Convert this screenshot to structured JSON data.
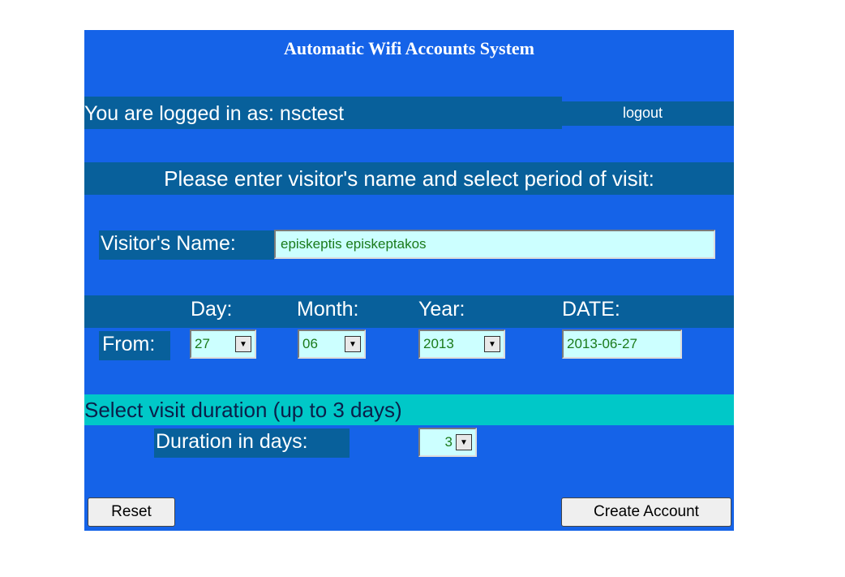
{
  "header": {
    "title": "Automatic Wifi Accounts System"
  },
  "session": {
    "logged_in_text": "You are logged in as: nsctest",
    "logout_label": "logout"
  },
  "prompt": "Please enter visitor's name and select period of visit:",
  "visitor": {
    "label": "Visitor's Name:",
    "value": "episkeptis episkeptakos"
  },
  "date_section": {
    "day_label": "Day:",
    "month_label": "Month:",
    "year_label": "Year:",
    "date_label": "DATE:",
    "from_label": "From:",
    "day_value": "27",
    "month_value": "06",
    "year_value": "2013",
    "date_value": "2013-06-27"
  },
  "duration": {
    "heading": "Select visit duration (up to 3 days)",
    "label": "Duration in days:",
    "value": "3"
  },
  "buttons": {
    "reset_label": "Reset",
    "create_label": "Create Account"
  },
  "icons": {
    "dropdown": "chevron-down-icon"
  },
  "colors": {
    "panel": "#1563e8",
    "band": "#08609b",
    "duration_band": "#00c8c8",
    "field_bg": "#ccffff"
  }
}
